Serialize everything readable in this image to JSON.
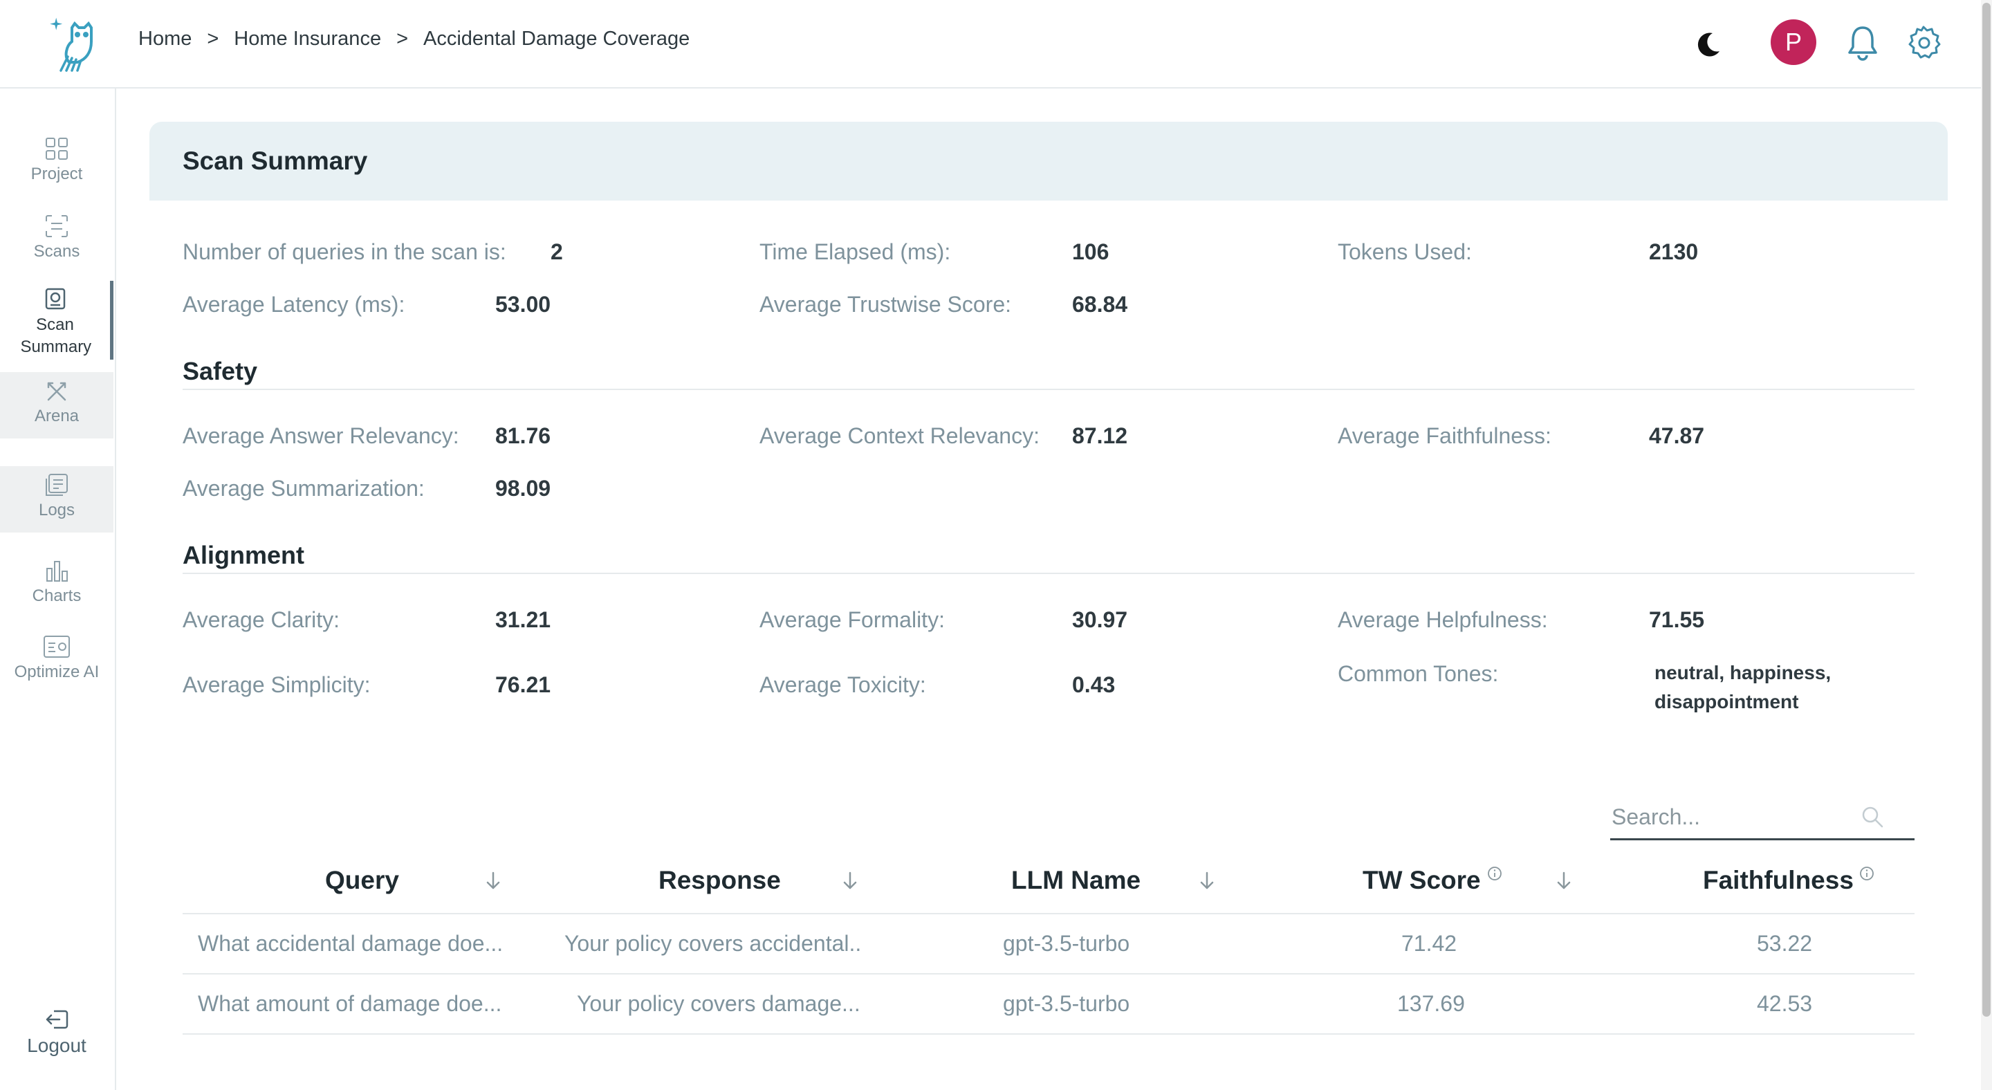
{
  "breadcrumb": {
    "items": [
      "Home",
      "Home Insurance",
      "Accidental Damage Coverage"
    ],
    "separator": ">"
  },
  "header": {
    "avatar_initial": "P",
    "avatar_color": "#c1245a"
  },
  "sidebar": {
    "items": [
      {
        "label": "Project",
        "icon": "grid-icon"
      },
      {
        "label": "Scans",
        "icon": "scan-icon"
      },
      {
        "label": "Scan Summary",
        "icon": "scan-summary-icon",
        "active": true
      },
      {
        "label": "Arena",
        "icon": "arena-icon",
        "disabled": true
      },
      {
        "label": "Logs",
        "icon": "logs-icon",
        "disabled": true
      },
      {
        "label": "Charts",
        "icon": "bar-chart-icon"
      },
      {
        "label": "Optimize AI",
        "icon": "optimize-icon"
      }
    ],
    "logout_label": "Logout"
  },
  "summary": {
    "title": "Scan Summary",
    "stats": {
      "queries_label": "Number of queries in the scan is:",
      "queries_value": "2",
      "time_label": "Time Elapsed (ms):",
      "time_value": "106",
      "tokens_label": "Tokens Used:",
      "tokens_value": "2130",
      "latency_label": "Average Latency (ms):",
      "latency_value": "53.00",
      "trustwise_label": "Average Trustwise Score:",
      "trustwise_value": "68.84"
    },
    "safety": {
      "title": "Safety",
      "answer_relevancy_label": "Average Answer Relevancy:",
      "answer_relevancy_value": "81.76",
      "context_relevancy_label": "Average Context Relevancy:",
      "context_relevancy_value": "87.12",
      "faithfulness_label": "Average Faithfulness:",
      "faithfulness_value": "47.87",
      "summarization_label": "Average Summarization:",
      "summarization_value": "98.09"
    },
    "alignment": {
      "title": "Alignment",
      "clarity_label": "Average Clarity:",
      "clarity_value": "31.21",
      "formality_label": "Average Formality:",
      "formality_value": "30.97",
      "helpfulness_label": "Average Helpfulness:",
      "helpfulness_value": "71.55",
      "simplicity_label": "Average Simplicity:",
      "simplicity_value": "76.21",
      "toxicity_label": "Average Toxicity:",
      "toxicity_value": "0.43",
      "tones_label": "Common Tones:",
      "tones_line1": "neutral, happiness,",
      "tones_line2": "disappointment"
    }
  },
  "search": {
    "placeholder": "Search..."
  },
  "table": {
    "headers": [
      "Query",
      "Response",
      "LLM Name",
      "TW Score",
      "Faithfulness"
    ],
    "rows": [
      [
        "What accidental damage doe...",
        "Your policy covers accidental..",
        "gpt-3.5-turbo",
        "71.42",
        "53.22"
      ],
      [
        "What amount of damage doe...",
        "Your policy covers damage...",
        "gpt-3.5-turbo",
        "137.69",
        "42.53"
      ]
    ]
  }
}
